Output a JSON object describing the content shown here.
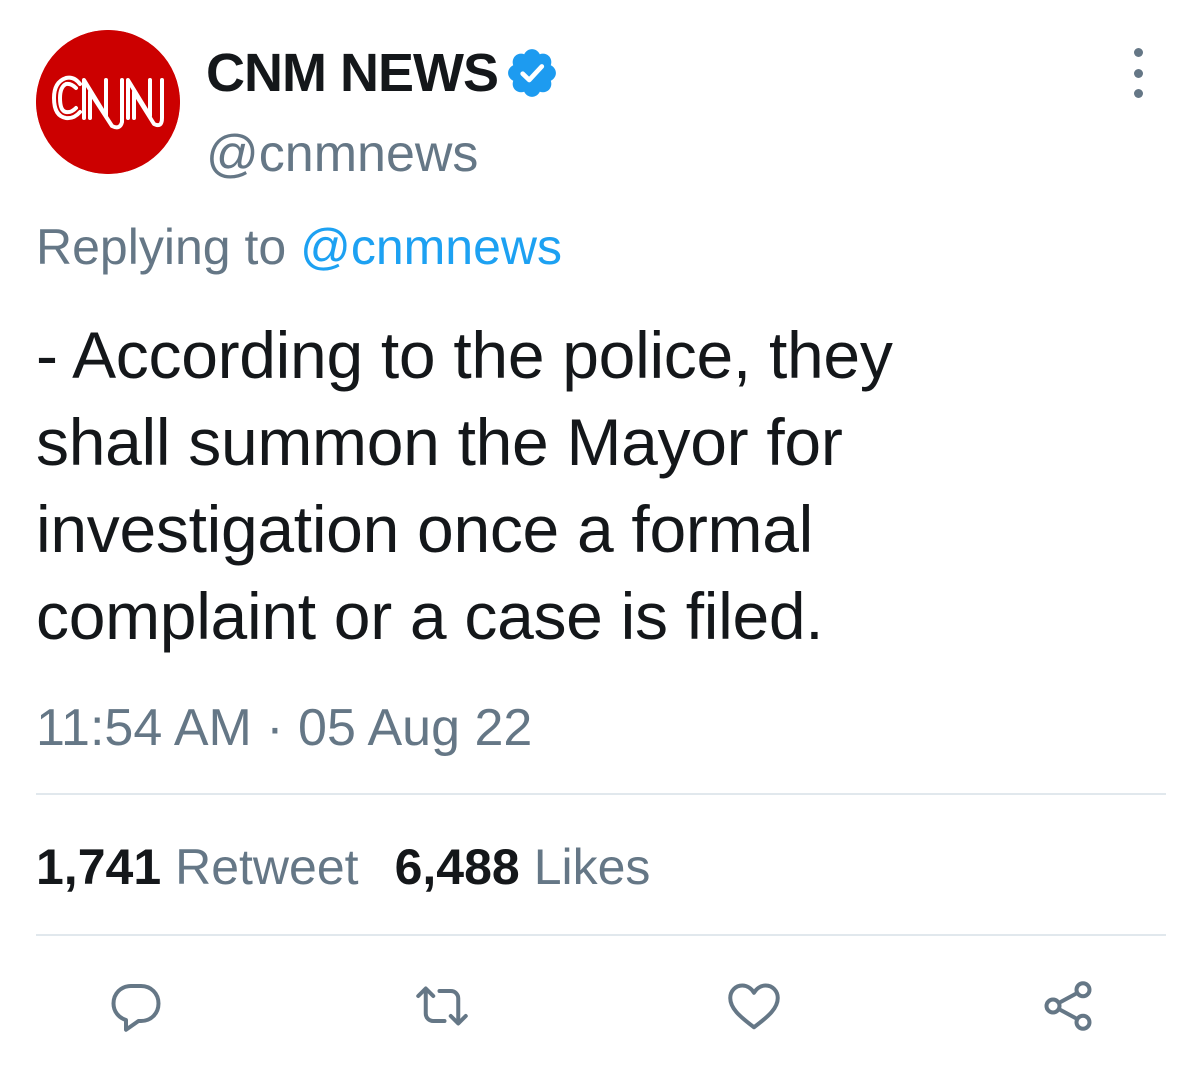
{
  "account": {
    "display_name": "CNM NEWS",
    "handle": "@cnmnews",
    "verified": true,
    "avatar_logo_text": "CNN"
  },
  "reply_context": {
    "prefix": "Replying to",
    "target": "@cnmnews"
  },
  "tweet": {
    "text_lines": [
      "- According to the police, they",
      "shall summon the Mayor for",
      "investigation once a formal",
      "complaint or a case is filed."
    ],
    "timestamp": "11:54 AM · 05 Aug 22"
  },
  "stats": {
    "retweets": {
      "count": "1,741",
      "label": "Retweet"
    },
    "likes": {
      "count": "6,488",
      "label": "Likes"
    }
  },
  "actions": {
    "icons": [
      "reply-icon",
      "retweet-icon",
      "like-icon",
      "share-icon"
    ]
  },
  "colors": {
    "avatar_red": "#cc0000",
    "verified_blue": "#1d9bf0",
    "link_blue": "#1da1f2",
    "muted_gray": "#657786",
    "text_dark": "#14171a",
    "divider": "#e1e8ed"
  }
}
